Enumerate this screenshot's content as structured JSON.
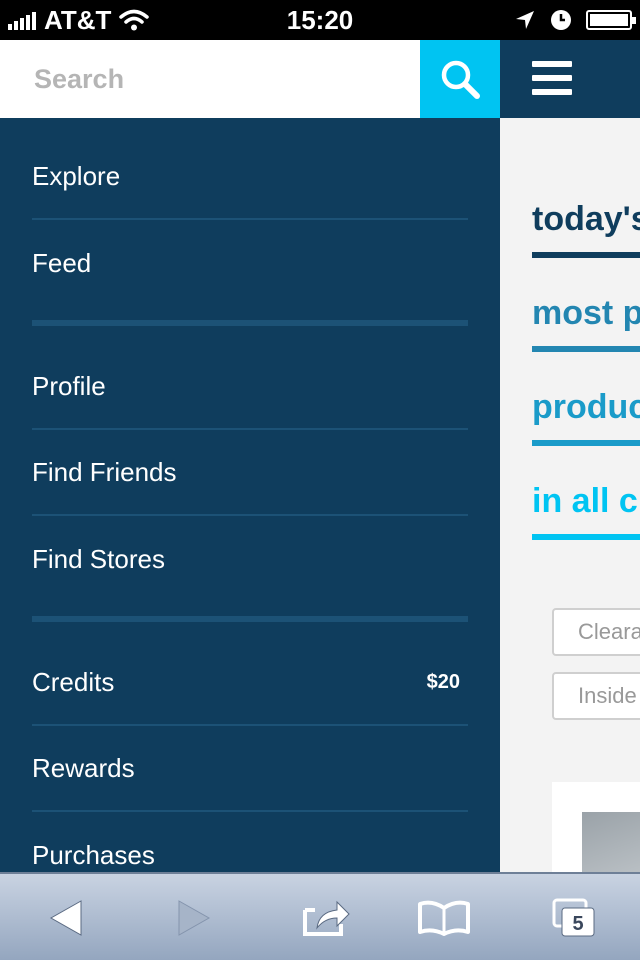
{
  "status_bar": {
    "carrier": "AT&T",
    "time": "15:20"
  },
  "search": {
    "placeholder": "Search"
  },
  "menu": {
    "section1": [
      {
        "label": "Explore"
      },
      {
        "label": "Feed"
      }
    ],
    "section2": [
      {
        "label": "Profile"
      },
      {
        "label": "Find Friends"
      },
      {
        "label": "Find Stores"
      }
    ],
    "section3": [
      {
        "label": "Credits",
        "badge": "$20"
      },
      {
        "label": "Rewards"
      },
      {
        "label": "Purchases"
      }
    ]
  },
  "content": {
    "tabs": [
      {
        "label": "today's",
        "color": "#0f3d5d"
      },
      {
        "label": "most p",
        "color": "#2386b1"
      },
      {
        "label": "produc",
        "color": "#1a9bc9"
      },
      {
        "label": "in all c",
        "color": "#00c4f2"
      }
    ],
    "filters": [
      {
        "label": "Cleara"
      },
      {
        "label": "Inside"
      }
    ]
  },
  "toolbar": {
    "tabs_count": "5"
  },
  "colors": {
    "menu_bg": "#0f3d5d",
    "accent": "#00c4f2"
  }
}
